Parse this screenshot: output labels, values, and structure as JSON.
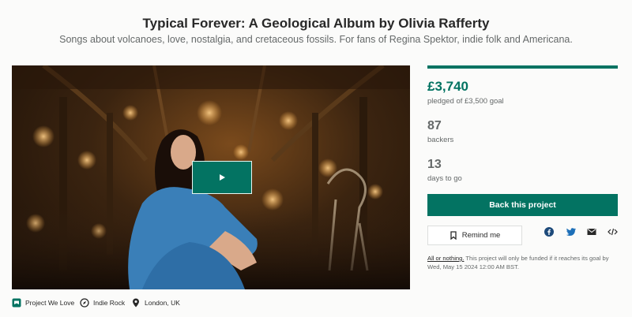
{
  "project": {
    "title": "Typical Forever: A Geological Album by Olivia Rafferty",
    "subtitle": "Songs about volcanoes, love, nostalgia, and cretaceous fossils. For fans of Regina Spektor, indie folk and Americana."
  },
  "stats": {
    "pledged": "£3,740",
    "pledged_label": "pledged of £3,500 goal",
    "progress": 1.0,
    "backers": "87",
    "backers_label": "backers",
    "days": "13",
    "days_label": "days to go"
  },
  "actions": {
    "back_label": "Back this project",
    "remind_label": "Remind me"
  },
  "fine_print": {
    "link": "All or nothing.",
    "text": " This project will only be funded if it reaches its goal by Wed, May 15 2024 12:00 AM BST."
  },
  "meta": {
    "badge": "Project We Love",
    "category": "Indie Rock",
    "location": "London, UK"
  },
  "colors": {
    "accent": "#037362",
    "text": "#282828",
    "muted": "#656969"
  },
  "icons": [
    "play-icon",
    "bookmark-icon",
    "facebook-icon",
    "twitter-icon",
    "email-icon",
    "embed-icon",
    "project-we-love-icon",
    "compass-icon",
    "location-pin-icon"
  ]
}
